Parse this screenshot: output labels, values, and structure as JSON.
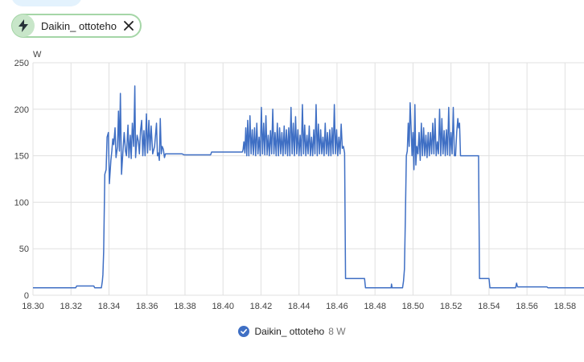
{
  "entity_chip": {
    "label": "Daikin_ ottoteho",
    "icon": "lightning-bolt-icon",
    "close_icon": "close-icon"
  },
  "legend": {
    "name": "Daikin_ ottoteho",
    "value": "8 W"
  },
  "colors": {
    "series": "#3f6fc4",
    "chip_border": "#a5d6a7",
    "chip_avatar": "#c8e6c9",
    "grid": "#e0e0e0"
  },
  "chart_data": {
    "type": "line",
    "title": "",
    "xlabel": "",
    "ylabel": "W",
    "xlim": [
      18.3,
      18.59
    ],
    "ylim": [
      0,
      250
    ],
    "x_ticks": [
      "18.30",
      "18.32",
      "18.34",
      "18.36",
      "18.38",
      "18.40",
      "18.42",
      "18.44",
      "18.46",
      "18.48",
      "18.50",
      "18.52",
      "18.54",
      "18.56",
      "18.58"
    ],
    "y_ticks": [
      "0",
      "50",
      "100",
      "150",
      "200",
      "250"
    ],
    "grid": true,
    "legend_position": "bottom-center",
    "series": [
      {
        "name": "Daikin_ ottoteho",
        "points": [
          [
            18.3,
            8
          ],
          [
            18.3225,
            8
          ],
          [
            18.323,
            10
          ],
          [
            18.332,
            10
          ],
          [
            18.3325,
            8
          ],
          [
            18.336,
            8
          ],
          [
            18.3365,
            15
          ],
          [
            18.3368,
            22
          ],
          [
            18.3372,
            47
          ],
          [
            18.3378,
            130
          ],
          [
            18.3385,
            135
          ],
          [
            18.339,
            170
          ],
          [
            18.3397,
            175
          ],
          [
            18.3402,
            120
          ],
          [
            18.341,
            145
          ],
          [
            18.3415,
            155
          ],
          [
            18.342,
            168
          ],
          [
            18.3425,
            162
          ],
          [
            18.3432,
            180
          ],
          [
            18.3437,
            148
          ],
          [
            18.3445,
            160
          ],
          [
            18.345,
            198
          ],
          [
            18.3455,
            155
          ],
          [
            18.346,
            217
          ],
          [
            18.3466,
            130
          ],
          [
            18.3472,
            150
          ],
          [
            18.348,
            175
          ],
          [
            18.3487,
            155
          ],
          [
            18.3492,
            150
          ],
          [
            18.35,
            183
          ],
          [
            18.3505,
            148
          ],
          [
            18.3512,
            172
          ],
          [
            18.3517,
            147
          ],
          [
            18.3523,
            185
          ],
          [
            18.353,
            160
          ],
          [
            18.3536,
            225
          ],
          [
            18.354,
            148
          ],
          [
            18.3548,
            172
          ],
          [
            18.3555,
            165
          ],
          [
            18.356,
            152
          ],
          [
            18.3566,
            177
          ],
          [
            18.3572,
            188
          ],
          [
            18.3578,
            150
          ],
          [
            18.3584,
            177
          ],
          [
            18.359,
            150
          ],
          [
            18.3597,
            195
          ],
          [
            18.3603,
            153
          ],
          [
            18.361,
            188
          ],
          [
            18.3616,
            156
          ],
          [
            18.3622,
            182
          ],
          [
            18.363,
            152
          ],
          [
            18.364,
            160
          ],
          [
            18.365,
            185
          ],
          [
            18.3655,
            150
          ],
          [
            18.366,
            153
          ],
          [
            18.3665,
            145
          ],
          [
            18.367,
            190
          ],
          [
            18.3675,
            152
          ],
          [
            18.368,
            160
          ],
          [
            18.3686,
            157
          ],
          [
            18.3692,
            148
          ],
          [
            18.3697,
            152
          ],
          [
            18.37,
            152
          ],
          [
            18.3785,
            152
          ],
          [
            18.3795,
            151
          ],
          [
            18.3935,
            151
          ],
          [
            18.394,
            154
          ],
          [
            18.4102,
            154
          ],
          [
            18.4106,
            157
          ],
          [
            18.411,
            165
          ],
          [
            18.4115,
            153
          ],
          [
            18.412,
            180
          ],
          [
            18.4125,
            150
          ],
          [
            18.413,
            188
          ],
          [
            18.4136,
            150
          ],
          [
            18.4142,
            193
          ],
          [
            18.4148,
            152
          ],
          [
            18.4154,
            178
          ],
          [
            18.416,
            151
          ],
          [
            18.4166,
            180
          ],
          [
            18.4172,
            150
          ],
          [
            18.4178,
            185
          ],
          [
            18.4184,
            152
          ],
          [
            18.419,
            170
          ],
          [
            18.4196,
            150
          ],
          [
            18.4202,
            202
          ],
          [
            18.4208,
            152
          ],
          [
            18.4214,
            185
          ],
          [
            18.422,
            151
          ],
          [
            18.4226,
            193
          ],
          [
            18.4232,
            151
          ],
          [
            18.4238,
            172
          ],
          [
            18.4244,
            150
          ],
          [
            18.425,
            177
          ],
          [
            18.4256,
            152
          ],
          [
            18.4262,
            200
          ],
          [
            18.4268,
            152
          ],
          [
            18.4274,
            175
          ],
          [
            18.428,
            150
          ],
          [
            18.4286,
            185
          ],
          [
            18.4292,
            150
          ],
          [
            18.4298,
            180
          ],
          [
            18.4304,
            152
          ],
          [
            18.431,
            175
          ],
          [
            18.4316,
            150
          ],
          [
            18.4322,
            182
          ],
          [
            18.4328,
            152
          ],
          [
            18.4334,
            178
          ],
          [
            18.434,
            150
          ],
          [
            18.4346,
            180
          ],
          [
            18.4352,
            150
          ],
          [
            18.4358,
            202
          ],
          [
            18.4364,
            152
          ],
          [
            18.437,
            185
          ],
          [
            18.4376,
            150
          ],
          [
            18.4382,
            192
          ],
          [
            18.4388,
            152
          ],
          [
            18.4394,
            178
          ],
          [
            18.44,
            150
          ],
          [
            18.4406,
            172
          ],
          [
            18.4412,
            150
          ],
          [
            18.4418,
            205
          ],
          [
            18.4424,
            152
          ],
          [
            18.443,
            183
          ],
          [
            18.4436,
            150
          ],
          [
            18.4442,
            172
          ],
          [
            18.4448,
            152
          ],
          [
            18.4454,
            182
          ],
          [
            18.446,
            150
          ],
          [
            18.4466,
            170
          ],
          [
            18.4472,
            150
          ],
          [
            18.4478,
            178
          ],
          [
            18.4484,
            152
          ],
          [
            18.449,
            205
          ],
          [
            18.4496,
            150
          ],
          [
            18.4502,
            184
          ],
          [
            18.4508,
            152
          ],
          [
            18.4514,
            178
          ],
          [
            18.452,
            152
          ],
          [
            18.4526,
            170
          ],
          [
            18.4532,
            150
          ],
          [
            18.4538,
            185
          ],
          [
            18.4544,
            152
          ],
          [
            18.455,
            175
          ],
          [
            18.4556,
            150
          ],
          [
            18.4562,
            178
          ],
          [
            18.4568,
            150
          ],
          [
            18.4574,
            180
          ],
          [
            18.458,
            152
          ],
          [
            18.4586,
            205
          ],
          [
            18.4592,
            152
          ],
          [
            18.4598,
            178
          ],
          [
            18.4604,
            150
          ],
          [
            18.461,
            170
          ],
          [
            18.4616,
            152
          ],
          [
            18.4622,
            184
          ],
          [
            18.4628,
            158
          ],
          [
            18.4634,
            160
          ],
          [
            18.464,
            153
          ],
          [
            18.4645,
            18
          ],
          [
            18.4745,
            18
          ],
          [
            18.475,
            8
          ],
          [
            18.4885,
            8
          ],
          [
            18.4887,
            12
          ],
          [
            18.489,
            8
          ],
          [
            18.4945,
            8
          ],
          [
            18.495,
            15
          ],
          [
            18.4955,
            28
          ],
          [
            18.496,
            85
          ],
          [
            18.4965,
            150
          ],
          [
            18.497,
            155
          ],
          [
            18.4975,
            185
          ],
          [
            18.498,
            160
          ],
          [
            18.4985,
            207
          ],
          [
            18.499,
            180
          ],
          [
            18.4995,
            150
          ],
          [
            18.5,
            175
          ],
          [
            18.5005,
            135
          ],
          [
            18.501,
            205
          ],
          [
            18.5015,
            140
          ],
          [
            18.502,
            160
          ],
          [
            18.5026,
            152
          ],
          [
            18.5032,
            175
          ],
          [
            18.5038,
            145
          ],
          [
            18.5044,
            185
          ],
          [
            18.505,
            150
          ],
          [
            18.5056,
            180
          ],
          [
            18.5062,
            150
          ],
          [
            18.5068,
            172
          ],
          [
            18.5074,
            148
          ],
          [
            18.508,
            175
          ],
          [
            18.5086,
            150
          ],
          [
            18.5092,
            175
          ],
          [
            18.5098,
            152
          ],
          [
            18.5104,
            185
          ],
          [
            18.511,
            152
          ],
          [
            18.5116,
            190
          ],
          [
            18.5122,
            150
          ],
          [
            18.5128,
            165
          ],
          [
            18.5134,
            152
          ],
          [
            18.514,
            200
          ],
          [
            18.5146,
            150
          ],
          [
            18.5152,
            190
          ],
          [
            18.5158,
            152
          ],
          [
            18.5164,
            177
          ],
          [
            18.517,
            150
          ],
          [
            18.5176,
            178
          ],
          [
            18.5182,
            151
          ],
          [
            18.5188,
            202
          ],
          [
            18.5194,
            150
          ],
          [
            18.52,
            175
          ],
          [
            18.5206,
            152
          ],
          [
            18.5212,
            202
          ],
          [
            18.5218,
            150
          ],
          [
            18.5224,
            150
          ],
          [
            18.523,
            175
          ],
          [
            18.5236,
            190
          ],
          [
            18.524,
            180
          ],
          [
            18.5245,
            185
          ],
          [
            18.525,
            150
          ],
          [
            18.5345,
            150
          ],
          [
            18.535,
            18
          ],
          [
            18.54,
            18
          ],
          [
            18.5405,
            8
          ],
          [
            18.554,
            8
          ],
          [
            18.5545,
            13
          ],
          [
            18.555,
            9
          ],
          [
            18.5705,
            9
          ],
          [
            18.571,
            8
          ],
          [
            18.59,
            8
          ]
        ]
      }
    ]
  }
}
